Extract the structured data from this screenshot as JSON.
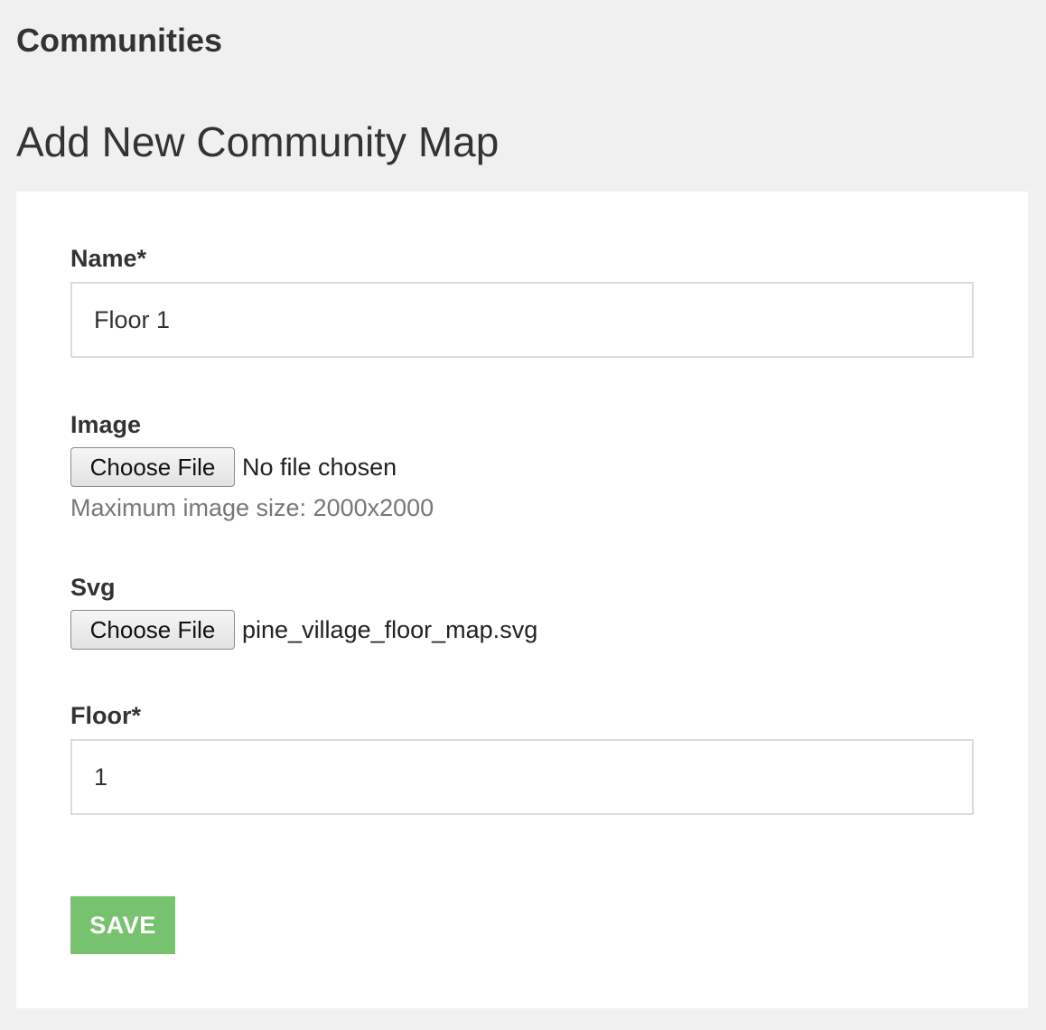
{
  "header": {
    "section_title": "Communities",
    "page_title": "Add New Community Map"
  },
  "form": {
    "name": {
      "label": "Name*",
      "value": "Floor 1"
    },
    "image": {
      "label": "Image",
      "button_label": "Choose File",
      "file_status": "No file chosen",
      "help_text": "Maximum image size: 2000x2000"
    },
    "svg": {
      "label": "Svg",
      "button_label": "Choose File",
      "file_status": "pine_village_floor_map.svg"
    },
    "floor": {
      "label": "Floor*",
      "value": "1"
    },
    "save_label": "SAVE"
  },
  "colors": {
    "page_background": "#f0f0f0",
    "card_background": "#ffffff",
    "save_button": "#77c26f",
    "text_primary": "#333333",
    "text_muted": "#777777"
  }
}
